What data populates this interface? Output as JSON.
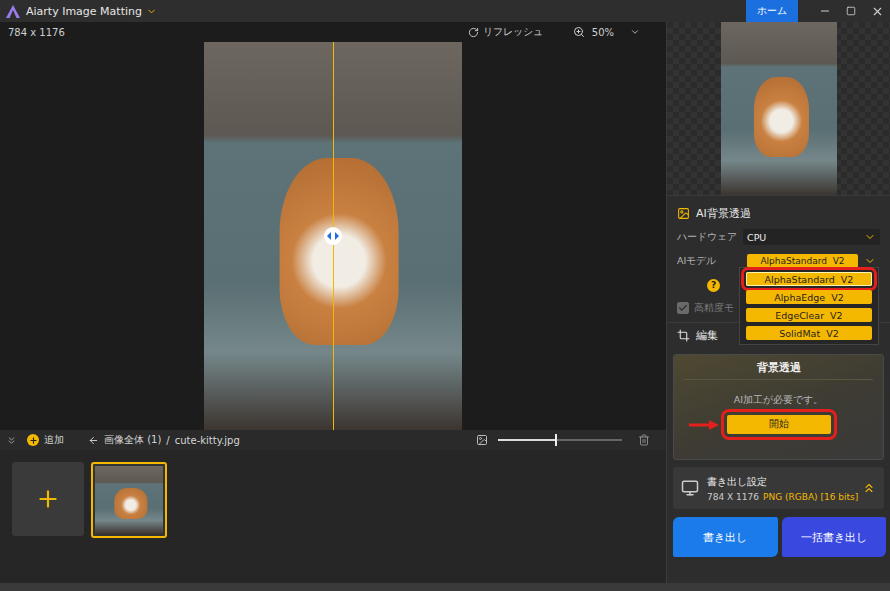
{
  "window": {
    "title": "Aiarty Image Matting",
    "home_button": "ホーム"
  },
  "canvas_bar": {
    "dimensions": "784 x 1176",
    "refresh": "リフレッシュ",
    "zoom": "50%"
  },
  "image_strip": {
    "add": "追加",
    "breadcrumb_root": "画像全体 (1)",
    "separator": "/",
    "file": "cute-kitty.jpg",
    "thumbnail_size_level": 0.46
  },
  "thumbnails": [
    {
      "selected": true
    }
  ],
  "ai_section": {
    "title": "AI背景透過",
    "hardware_label": "ハードウェア",
    "hardware_value": "CPU",
    "model_label": "AIモデル",
    "model_value": "AlphaStandard  V2",
    "help": "?",
    "high_precision": {
      "label": "高精度モ",
      "checked": true,
      "disabled": true
    }
  },
  "model_menu": {
    "open": true,
    "items": [
      {
        "label": "AlphaStandard  V2",
        "selected": true,
        "annotated": true
      },
      {
        "label": "AlphaEdge  V2",
        "selected": false,
        "annotated": false
      },
      {
        "label": "EdgeClear  V2",
        "selected": false,
        "annotated": false
      },
      {
        "label": "SolidMat  V2",
        "selected": false,
        "annotated": false
      }
    ]
  },
  "edit_section": {
    "title": "編集"
  },
  "removal_card": {
    "title": "背景透過",
    "message": "AI加工が必要です。",
    "button": "開始",
    "button_annotated": true
  },
  "export_settings": {
    "title": "書き出し設定",
    "size": "784 X 1176",
    "format": "PNG (RGBA) [16 bits]"
  },
  "buttons": [
    {
      "label": "書き出し",
      "kind": "primary"
    },
    {
      "label": "一括書き出し",
      "kind": "batch"
    }
  ]
}
